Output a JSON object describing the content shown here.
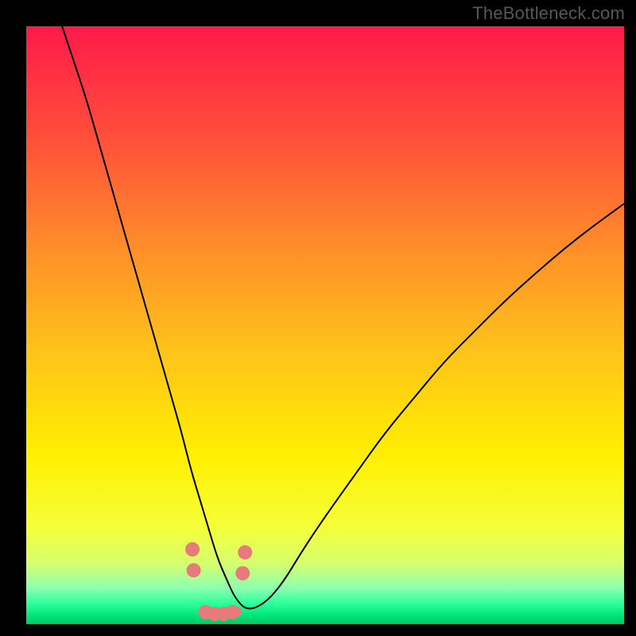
{
  "watermark": "TheBottleneck.com",
  "chart_data": {
    "type": "line",
    "title": "",
    "xlabel": "",
    "ylabel": "",
    "xlim": [
      0,
      100
    ],
    "ylim": [
      0,
      100
    ],
    "grid": false,
    "legend": false,
    "background_gradient_stops": [
      {
        "offset": 0.0,
        "color": "#ff1a4a"
      },
      {
        "offset": 0.18,
        "color": "#ff4d3a"
      },
      {
        "offset": 0.36,
        "color": "#ff8a2a"
      },
      {
        "offset": 0.54,
        "color": "#ffc21a"
      },
      {
        "offset": 0.72,
        "color": "#fff000"
      },
      {
        "offset": 0.84,
        "color": "#f4ff3a"
      },
      {
        "offset": 0.9,
        "color": "#d4ff70"
      },
      {
        "offset": 0.94,
        "color": "#8cffb0"
      },
      {
        "offset": 0.965,
        "color": "#2fff9c"
      },
      {
        "offset": 0.985,
        "color": "#00e77a"
      },
      {
        "offset": 1.0,
        "color": "#00c964"
      }
    ],
    "series": [
      {
        "name": "bottleneck-curve",
        "color": "#000000",
        "stroke_width": 2,
        "x": [
          6,
          8,
          10,
          12,
          14,
          16,
          18,
          20,
          22,
          24,
          26,
          27.5,
          29,
          30.5,
          32,
          33.5,
          35,
          37,
          40,
          43,
          46,
          50,
          55,
          60,
          65,
          70,
          75,
          80,
          85,
          90,
          95,
          100
        ],
        "y": [
          100,
          94,
          88,
          81,
          74,
          67,
          60,
          53,
          46,
          39,
          32,
          26,
          21,
          16,
          11,
          7.5,
          4.2,
          2.2,
          3.5,
          7,
          12,
          18,
          25,
          32,
          38,
          44,
          49,
          54,
          58.5,
          62.8,
          66.7,
          70.3
        ]
      }
    ],
    "curve_markers": {
      "name": "match-band",
      "color": "#e77a7a",
      "points_x": [
        27.8,
        28.0,
        30.0,
        31.5,
        33.0,
        34.5,
        36.2,
        36.6
      ],
      "points_y": [
        12.5,
        9.0,
        2.0,
        1.7,
        1.7,
        2.0,
        8.5,
        12.0
      ],
      "radius": 9
    },
    "curve_band": {
      "name": "match-band-fill",
      "color": "#e77a7a",
      "x": [
        29.6,
        30.5,
        31.5,
        32.5,
        33.5,
        34.5,
        35.3
      ],
      "y": [
        2.0,
        1.75,
        1.7,
        1.7,
        1.75,
        1.9,
        2.1
      ],
      "half_width": 6
    }
  }
}
